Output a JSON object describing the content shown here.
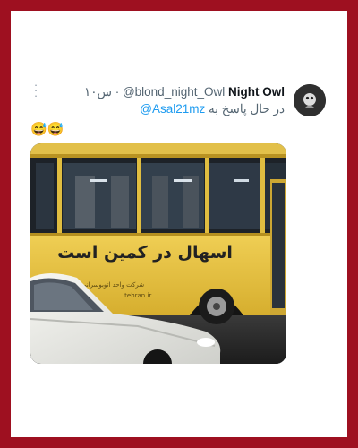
{
  "tweet": {
    "display_name": "Night Owl",
    "handle": "@blond_night_Owl",
    "time": "۱۰س",
    "reply_prefix": "در حال پاسخ به",
    "reply_user": "@Asal21mz",
    "body_emoji": "😅😅"
  },
  "media": {
    "bus_sign_text": "اسهال در کمین است",
    "bus_small_text": "شرکت واحد اتوبوسرانی",
    "bus_site_text": "..tehran.ir"
  },
  "colors": {
    "border": "#9e1020",
    "bus_yellow": "#e9c544",
    "link_blue": "#1d9bf0",
    "meta_gray": "#536471"
  }
}
